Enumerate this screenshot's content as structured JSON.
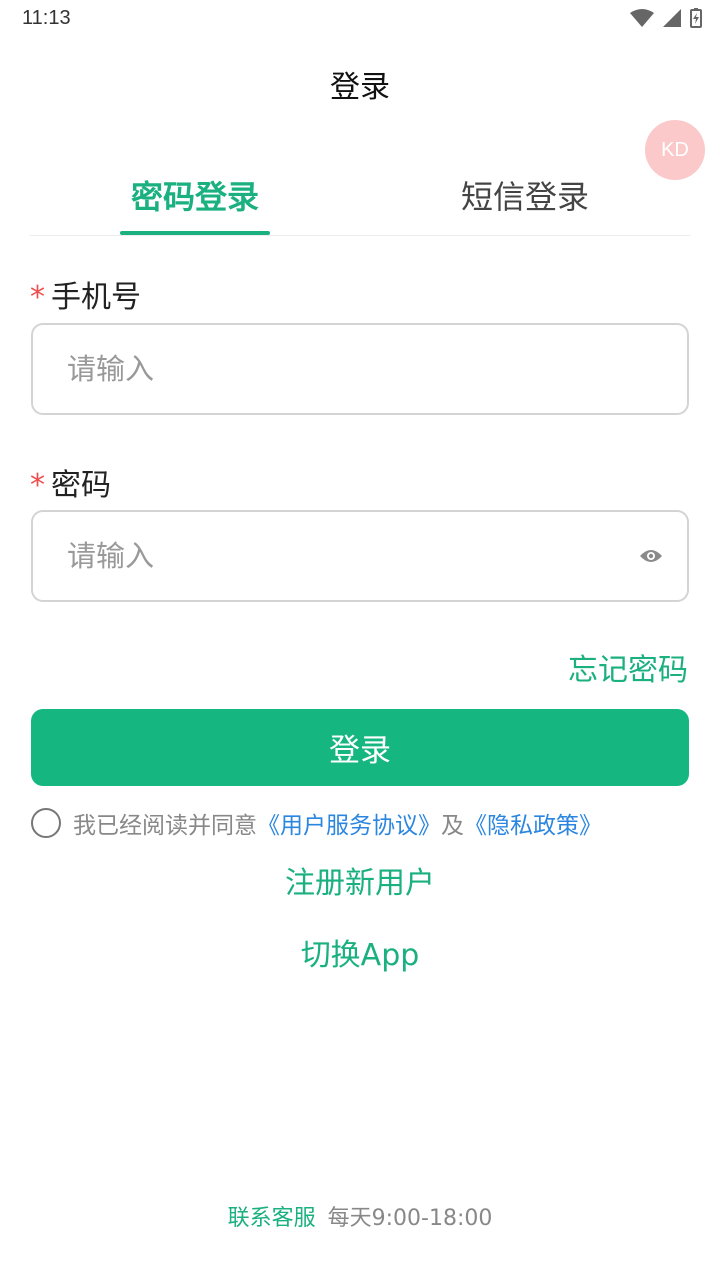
{
  "status_bar": {
    "time": "11:13"
  },
  "header": {
    "title": "登录"
  },
  "avatar": {
    "initials": "KD"
  },
  "tabs": [
    {
      "label": "密码登录",
      "active": true
    },
    {
      "label": "短信登录",
      "active": false
    }
  ],
  "form": {
    "phone": {
      "required_mark": "*",
      "label": "手机号",
      "placeholder": "请输入",
      "value": ""
    },
    "password": {
      "required_mark": "*",
      "label": "密码",
      "placeholder": "请输入",
      "value": ""
    }
  },
  "actions": {
    "forgot_password": "忘记密码",
    "login_label": "登录",
    "register": "注册新用户",
    "switch_app": "切换App"
  },
  "agreement": {
    "prefix": "我已经阅读并同意",
    "service_agreement": "《用户服务协议》",
    "conjunction": "及",
    "privacy_policy": "《隐私政策》"
  },
  "footer": {
    "service_label": "联系客服",
    "hours": "每天9:00-18:00"
  },
  "colors": {
    "accent": "#15b680",
    "link": "#2b86e0",
    "required": "#ee4d4d",
    "avatar_bg": "#fbc9c9"
  }
}
